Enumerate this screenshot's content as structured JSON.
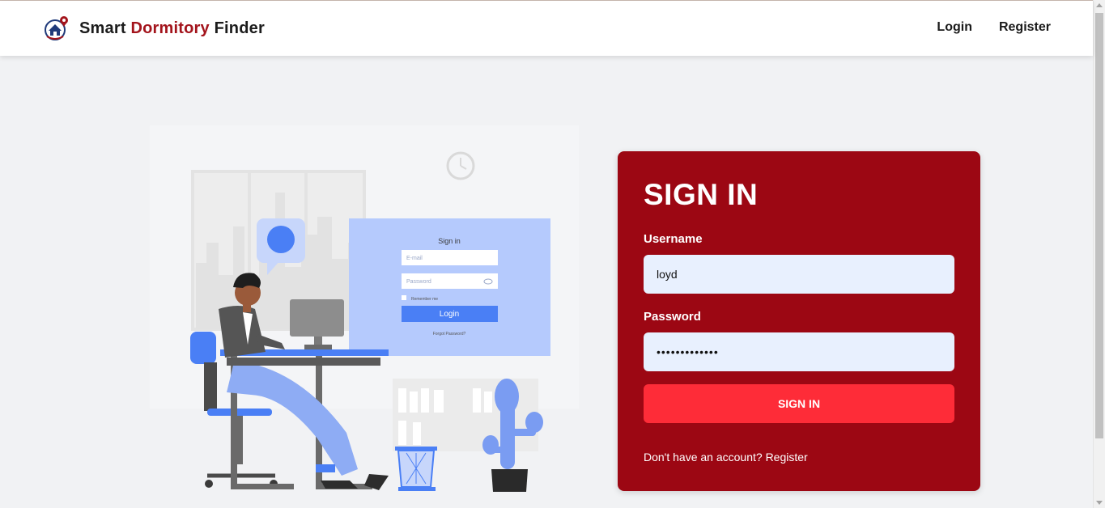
{
  "navbar": {
    "brand": {
      "part1": "Smart",
      "part2": "Dormitory",
      "part3": "Finder",
      "logo_icon": "house-location-pin-icon"
    },
    "links": {
      "login": "Login",
      "register": "Register"
    }
  },
  "illustration": {
    "mockup_title": "Sign in",
    "mockup_email_placeholder": "E-mail",
    "mockup_password_placeholder": "Password",
    "mockup_remember": "Remember me",
    "mockup_login_button": "Login",
    "mockup_forgot": "Forgot Password?"
  },
  "signin": {
    "title": "SIGN IN",
    "username_label": "Username",
    "username_value": "loyd",
    "password_label": "Password",
    "password_value": "•••••••••••••",
    "button_label": "SIGN IN",
    "register_prompt": "Don't have an account?",
    "register_link": "Register"
  },
  "colors": {
    "brand_accent": "#a3141c",
    "card_background": "#9c0713",
    "button_background": "#fe2c38",
    "input_background": "#e8f0fe",
    "page_background": "#f1f2f4",
    "illustration_blue": "#4a7ff5"
  }
}
